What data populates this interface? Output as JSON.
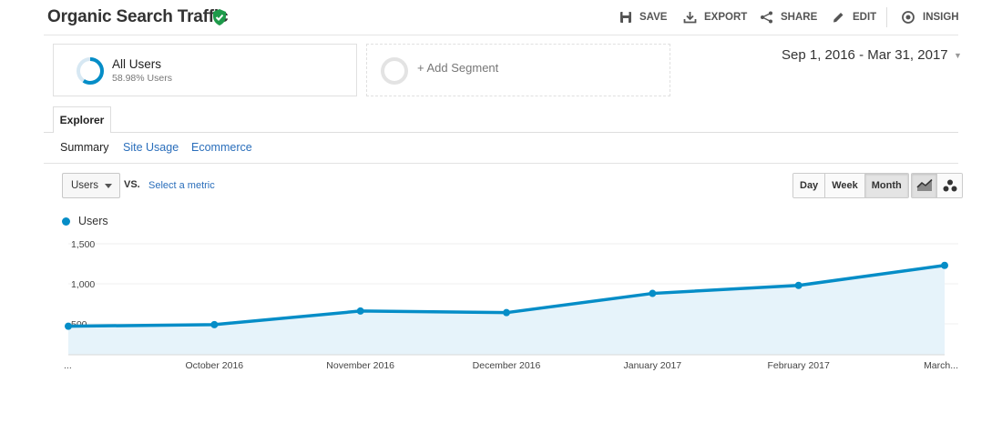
{
  "header": {
    "title": "Organic Search Traffic",
    "actions": [
      {
        "icon": "save-icon",
        "label": "SAVE"
      },
      {
        "icon": "export-icon",
        "label": "EXPORT"
      },
      {
        "icon": "share-icon",
        "label": "SHARE"
      },
      {
        "icon": "edit-icon",
        "label": "EDIT"
      },
      {
        "icon": "insights-icon",
        "label": "INSIGHTS"
      }
    ]
  },
  "segments": {
    "active": {
      "name": "All Users",
      "sub": "58.98% Users"
    },
    "add_label": "+ Add Segment"
  },
  "date_range": "Sep 1, 2016 - Mar 31, 2017",
  "tabs": {
    "explorer": "Explorer",
    "subtabs": [
      "Summary",
      "Site Usage",
      "Ecommerce"
    ]
  },
  "metric": {
    "selected": "Users",
    "vs": "VS.",
    "select_metric": "Select a metric"
  },
  "period": [
    "Day",
    "Week",
    "Month"
  ],
  "period_active": "Month",
  "legend": {
    "label": "Users",
    "color": "#058dc7"
  },
  "chart_data": {
    "type": "area",
    "x": [
      "...",
      "October 2016",
      "November 2016",
      "December 2016",
      "January 2017",
      "February 2017",
      "March..."
    ],
    "series": [
      {
        "name": "Users",
        "values": [
          470,
          490,
          660,
          640,
          880,
          980,
          1230
        ]
      }
    ],
    "y_ticks": [
      "1,500",
      "1,000",
      "500"
    ],
    "ylim": [
      0,
      1500
    ],
    "grid": true,
    "line_color": "#058dc7",
    "fill_color": "#e6f3fa"
  }
}
